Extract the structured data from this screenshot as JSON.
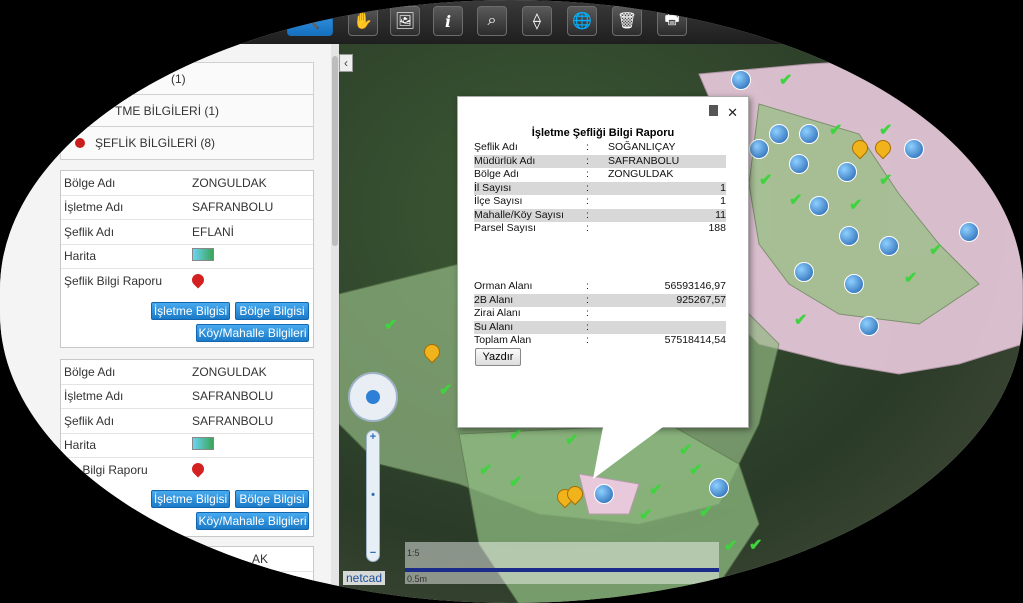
{
  "toolbar": {
    "buttons": [
      {
        "name": "search-button",
        "icon": "search-icon",
        "glyph": "🔍"
      },
      {
        "name": "pan-button",
        "icon": "hand-icon",
        "glyph": "✋"
      },
      {
        "name": "image-button",
        "icon": "image-icon",
        "glyph": "🖼"
      },
      {
        "name": "info-button",
        "icon": "info-icon",
        "glyph": "i"
      },
      {
        "name": "zoom-box-button",
        "icon": "magnifier-box-icon",
        "glyph": "⌕"
      },
      {
        "name": "measure-button",
        "icon": "measure-icon",
        "glyph": "⟠"
      },
      {
        "name": "globe-button",
        "icon": "globe-icon",
        "glyph": "🌐"
      },
      {
        "name": "delete-button",
        "icon": "trash-icon",
        "glyph": "🗑"
      },
      {
        "name": "print-button",
        "icon": "printer-icon",
        "glyph": "🖶"
      }
    ]
  },
  "panel": {
    "groups": [
      {
        "label": "(1)"
      },
      {
        "label": "TME BİLGİLERİ (1)"
      },
      {
        "label": "ŞEFLİK BİLGİLERİ (8)"
      }
    ],
    "cards": [
      {
        "bolge_k": "Bölge Adı",
        "bolge_v": "ZONGULDAK",
        "isletme_k": "İşletme Adı",
        "isletme_v": "SAFRANBOLU",
        "seflik_k": "Şeflik Adı",
        "seflik_v": "EFLANİ",
        "harita_k": "Harita",
        "rapor_k": "Şeflik Bilgi Raporu",
        "btn_isletme": "İşletme Bilgisi",
        "btn_bolge": "Bölge Bilgisi",
        "btn_koy": "Köy/Mahalle Bilgileri"
      },
      {
        "bolge_k": "Bölge Adı",
        "bolge_v": "ZONGULDAK",
        "isletme_k": "İşletme Adı",
        "isletme_v": "SAFRANBOLU",
        "seflik_k": "Şeflik Adı",
        "seflik_v": "SAFRANBOLU",
        "harita_k": "Harita",
        "rapor_k": "k Bilgi Raporu",
        "btn_isletme": "İşletme Bilgisi",
        "btn_bolge": "Bölge Bilgisi",
        "btn_koy": "Köy/Mahalle Bilgileri"
      }
    ],
    "third_card_partial": "AK"
  },
  "popup": {
    "title": "İşletme Şefliği Bilgi Raporu",
    "rows": [
      {
        "k": "Şeflik Adı",
        "s": ":",
        "v": "SOĞANLIÇAY",
        "align": "left"
      },
      {
        "k": "Müdürlük Adı",
        "s": ":",
        "v": "SAFRANBOLU",
        "align": "left"
      },
      {
        "k": "Bölge Adı",
        "s": ":",
        "v": "ZONGULDAK",
        "align": "left"
      },
      {
        "k": "İl Sayısı",
        "s": ":",
        "v": "1",
        "align": "right"
      },
      {
        "k": "İlçe Sayısı",
        "s": ":",
        "v": "1",
        "align": "right"
      },
      {
        "k": "Mahalle/Köy Sayısı",
        "s": ":",
        "v": "11",
        "align": "right"
      },
      {
        "k": "Parsel Sayısı",
        "s": ":",
        "v": "188",
        "align": "right"
      }
    ],
    "rows2": [
      {
        "k": "Orman Alanı",
        "s": ":",
        "v": "56593146,97",
        "align": "right"
      },
      {
        "k": "2B Alanı",
        "s": ":",
        "v": "925267,57",
        "align": "right"
      },
      {
        "k": "Zirai Alanı",
        "s": ":",
        "v": "",
        "align": "right"
      },
      {
        "k": "Su Alanı",
        "s": ":",
        "v": "",
        "align": "right"
      },
      {
        "k": "Toplam Alan",
        "s": ":",
        "v": "57518414,54",
        "align": "right"
      }
    ],
    "print_label": "Yazdır"
  },
  "map": {
    "scale_top": "1:5",
    "scale_bottom": "0.5m",
    "logo": "netcad"
  }
}
